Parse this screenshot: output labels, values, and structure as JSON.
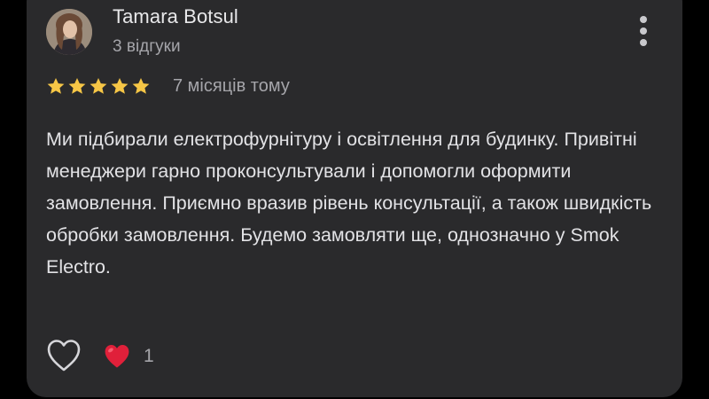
{
  "review": {
    "reviewer_name": "Tamara Botsul",
    "review_count": "3 відгуки",
    "rating": 5,
    "rating_max": 5,
    "date": "7 місяців тому",
    "text": "Ми підбирали електрофурнітуру і освітлення для будинку. Привітні менеджери гарно проконсультували і допомогли оформити замовлення. Приємно вразив рівень консультації, а також швидкість обробки замовлення. Будемо замовляти ще, однозначно у Smok Electro.",
    "reactions": {
      "heart_count": "1"
    }
  },
  "icons": {
    "more": "more-vert-icon",
    "star": "star-icon",
    "like": "heart-outline-icon",
    "reaction": "red-heart-icon"
  },
  "colors": {
    "background": "#000000",
    "card": "#2a2a2c",
    "star": "#f6c646",
    "heart_red": "#e0203a",
    "primary_text": "#e8e8ea",
    "secondary_text": "#a5a5aa"
  }
}
